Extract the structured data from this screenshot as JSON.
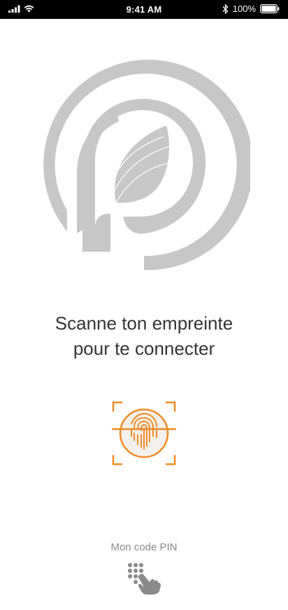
{
  "status_bar": {
    "time": "9:41 AM",
    "battery_percent": "100%",
    "icons": [
      "signal-icon",
      "wifi-icon",
      "bluetooth-icon",
      "battery-icon"
    ]
  },
  "logo": {
    "icon": "app-logo"
  },
  "prompt": {
    "line1": "Scanne ton empreinte",
    "line2": "pour te connecter"
  },
  "fingerprint": {
    "icon": "fingerprint-scan-icon",
    "accent_color": "#F08A24"
  },
  "pin": {
    "label": "Mon code PIN",
    "icon": "keypad-touch-icon"
  },
  "colors": {
    "logo_gray": "#C8C7C7",
    "text": "#333333",
    "muted": "#8A8A8A"
  }
}
